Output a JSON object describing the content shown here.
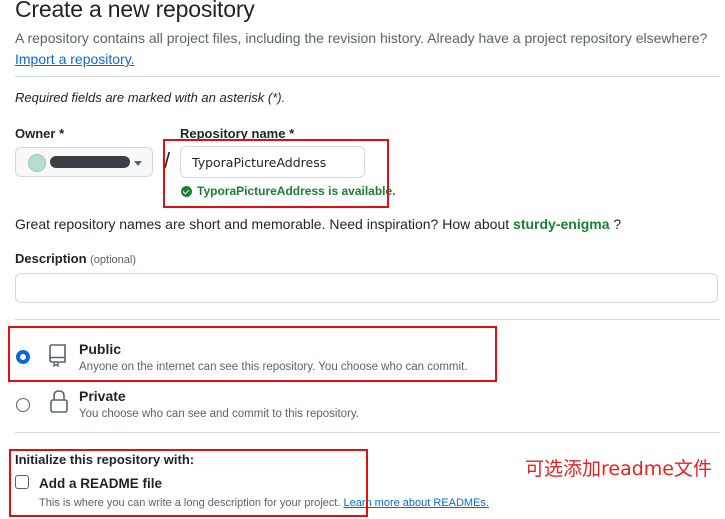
{
  "header": {
    "title": "Create a new repository",
    "intro": "A repository contains all project files, including the revision history. Already have a project repository elsewhere?",
    "import_link": "Import a repository."
  },
  "form": {
    "required_note": "Required fields are marked with an asterisk (*).",
    "owner": {
      "label": "Owner *"
    },
    "separator": "/",
    "repo_name": {
      "label": "Repository name *",
      "value": "TyporaPictureAddress",
      "availability": "TyporaPictureAddress is available."
    },
    "inspiration": {
      "text": "Great repository names are short and memorable. Need inspiration? How about",
      "suggestion": "sturdy-enigma",
      "suffix": " ?"
    },
    "description": {
      "label": "Description",
      "optional": "(optional)",
      "value": ""
    },
    "visibility": [
      {
        "title": "Public",
        "desc": "Anyone on the internet can see this repository. You choose who can commit.",
        "checked": true,
        "icon": "repo-icon"
      },
      {
        "title": "Private",
        "desc": "You choose who can see and commit to this repository.",
        "checked": false,
        "icon": "lock-icon"
      }
    ],
    "initialize": {
      "heading": "Initialize this repository with:",
      "readme_label": "Add a README file",
      "readme_desc": "This is where you can write a long description for your project.",
      "readme_link": "Learn more about READMEs."
    }
  },
  "annotation": {
    "text": "可选添加readme文件",
    "color": "#e82020"
  },
  "colors": {
    "link": "#0969da",
    "success": "#1a7f37",
    "highlight": "#e01010"
  }
}
